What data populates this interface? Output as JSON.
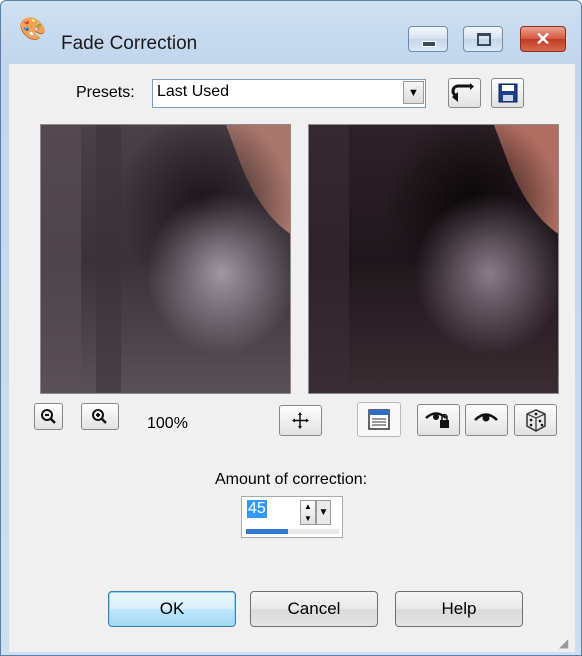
{
  "window": {
    "title": "Fade Correction",
    "title_icon": "palette-icon"
  },
  "presets": {
    "label": "Presets:",
    "value": "Last Used",
    "reset_icon": "reset-arrow-icon",
    "save_icon": "floppy-disk-icon"
  },
  "preview": {
    "zoom_level": "100%"
  },
  "amount": {
    "label": "Amount of correction:",
    "value": "45",
    "level": 0.45
  },
  "buttons": {
    "ok": "OK",
    "cancel": "Cancel",
    "help": "Help"
  },
  "colors": {
    "title_bg": "#c2d6ec",
    "close_red": "#c23a22",
    "accent_blue": "#3399ff"
  }
}
